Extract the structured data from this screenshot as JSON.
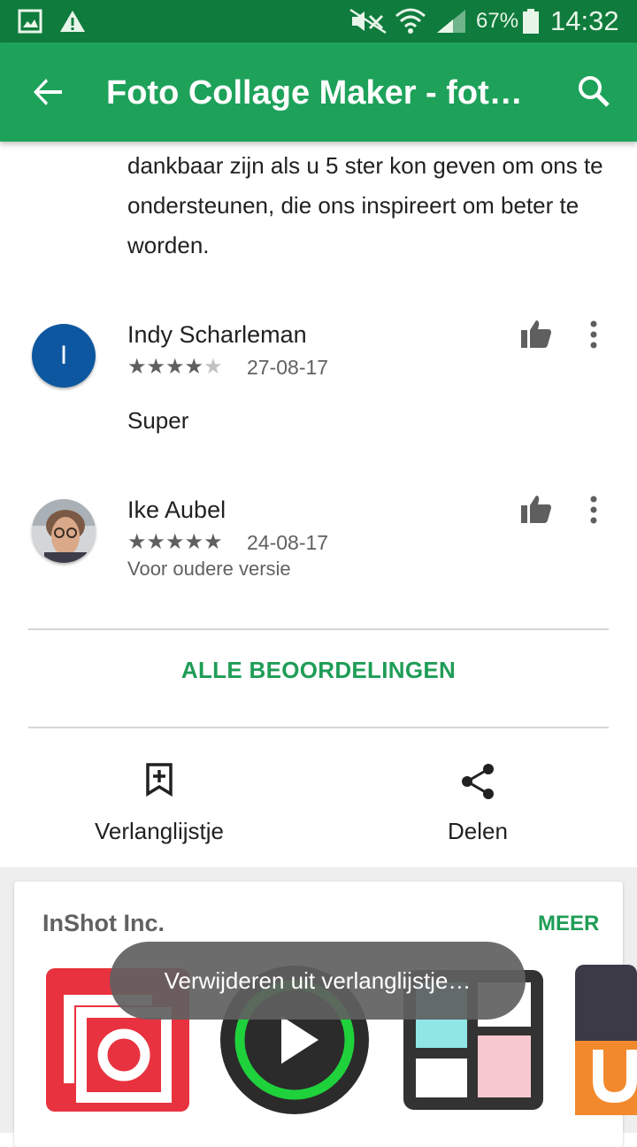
{
  "status_bar": {
    "battery": "67%",
    "time": "14:32",
    "icons": [
      "gallery-icon",
      "warning-icon",
      "mute-icon",
      "wifi-icon",
      "signal-icon",
      "battery-icon"
    ]
  },
  "app_bar": {
    "title": "Foto Collage Maker - foto…",
    "back_icon": "arrow-back-icon",
    "search_icon": "search-icon"
  },
  "reply_text": "dankbaar zijn als u 5 ster kon geven om ons te ondersteunen, die ons inspireert om beter te worden.",
  "reviews": [
    {
      "avatar_initial": "I",
      "avatar_color": "#0d57a0",
      "name": "Indy Scharleman",
      "rating": 4,
      "stars_filled": "★★★★",
      "stars_empty": "★",
      "date": "27-08-17",
      "text": "Super"
    },
    {
      "name": "Ike Aubel",
      "rating": 5,
      "stars_filled": "★★★★★",
      "stars_empty": "",
      "date": "24-08-17",
      "note": "Voor oudere versie"
    }
  ],
  "all_reviews_label": "ALLE BEOORDELINGEN",
  "actions": {
    "wishlist_label": "Verlanglijstje",
    "share_label": "Delen"
  },
  "developer_card": {
    "developer": "InShot Inc.",
    "more_label": "MEER",
    "apps": [
      "inshot-app-icon",
      "video-player-app-icon",
      "collage-app-icon",
      "camera-app-icon"
    ]
  },
  "toast": "Verwijderen uit verlanglijstje…",
  "colors": {
    "status_bar": "#0f7b3c",
    "app_bar": "#1ea25a",
    "accent": "#1f9d57"
  }
}
